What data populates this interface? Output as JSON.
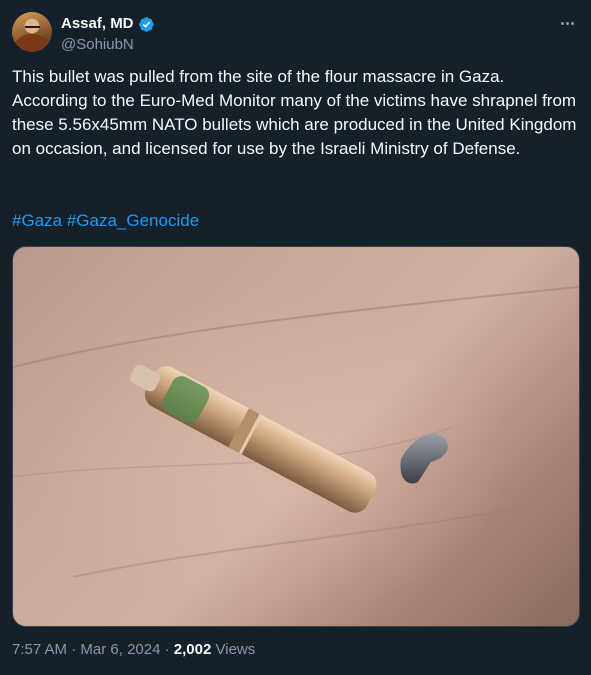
{
  "author": {
    "display_name": "Assaf, MD",
    "handle": "@SohiubN",
    "verified": true
  },
  "tweet": {
    "text": "This bullet was pulled from the site of the flour massacre in Gaza.\nAccording to the Euro-Med Monitor many of the victims have shrapnel from these 5.56x45mm NATO bullets which are produced in the United Kingdom on occasion, and licensed for use by the Israeli Ministry of Defense.",
    "hashtags": [
      "#Gaza",
      "#Gaza_Genocide"
    ]
  },
  "meta": {
    "time": "7:57 AM",
    "separator": "·",
    "date": "Mar 6, 2024",
    "views_count": "2,002",
    "views_label": "Views"
  },
  "colors": {
    "background": "#15202b",
    "text": "#f7f9f9",
    "secondary": "#8b98a5",
    "accent": "#1d9bf0"
  },
  "icons": {
    "verified": "verified-badge-icon",
    "more": "more-horizontal-icon"
  }
}
